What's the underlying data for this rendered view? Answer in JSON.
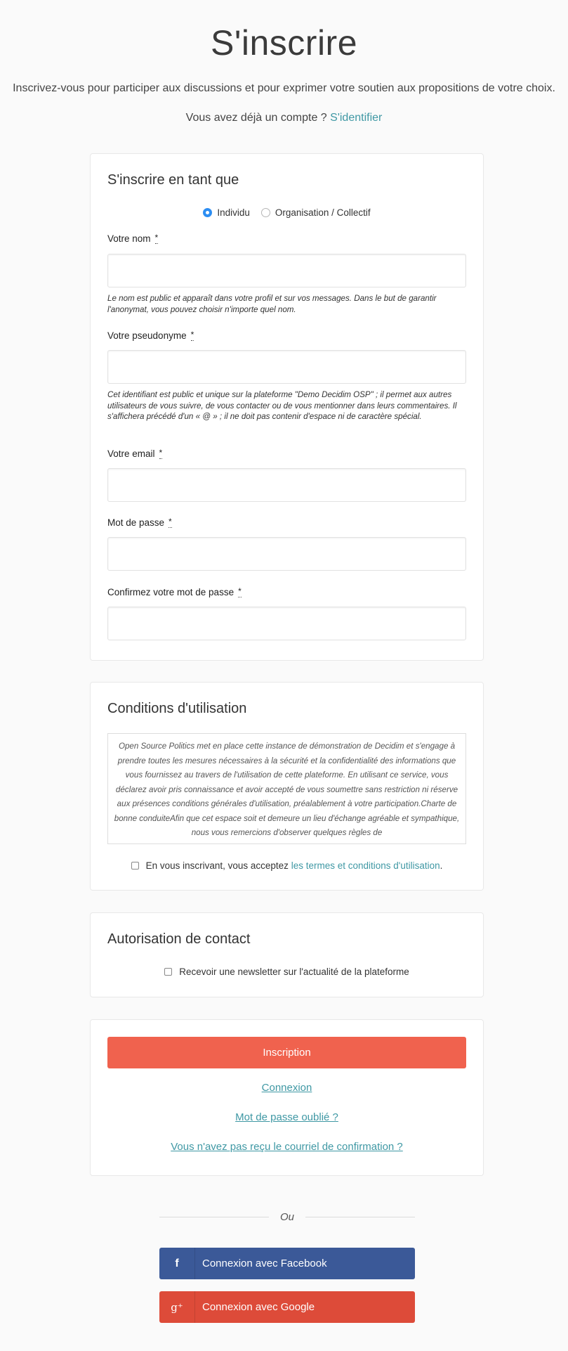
{
  "header": {
    "title": "S'inscrire",
    "subtitle": "Inscrivez-vous pour participer aux discussions et pour exprimer votre soutien aux propositions de votre choix.",
    "have_account": "Vous avez déjà un compte ?",
    "sign_in_link": "S'identifier"
  },
  "signup": {
    "title": "S'inscrire en tant que",
    "user_types": [
      {
        "label": "Individu",
        "selected": true
      },
      {
        "label": "Organisation / Collectif",
        "selected": false
      }
    ],
    "required_mark": "*",
    "fields": {
      "name": {
        "label": "Votre nom",
        "value": "",
        "help": "Le nom est public et apparaît dans votre profil et sur vos messages. Dans le but de garantir l'anonymat, vous pouvez choisir n'importe quel nom."
      },
      "nickname": {
        "label": "Votre pseudonyme",
        "value": "",
        "help": "Cet identifiant est public et unique sur la plateforme \"Demo Decidim OSP\" ; il permet aux autres utilisateurs de vous suivre, de vous contacter ou de vous mentionner dans leurs commentaires. Il s'affichera précédé d'un « @ » ; il ne doit pas contenir d'espace ni de caractère spécial."
      },
      "email": {
        "label": "Votre email",
        "value": ""
      },
      "password": {
        "label": "Mot de passe",
        "value": ""
      },
      "password_confirm": {
        "label": "Confirmez votre mot de passe",
        "value": ""
      }
    }
  },
  "tos": {
    "title": "Conditions d'utilisation",
    "text": "Open Source Politics met en place cette instance de démonstration de Decidim et s'engage à prendre toutes les mesures nécessaires à la sécurité et la confidentialité des informations que vous fournissez au travers de l'utilisation de cette plateforme. En utilisant ce service, vous déclarez avoir pris connaissance et avoir accepté de vous soumettre sans restriction ni réserve aux présences conditions générales d'utilisation, préalablement à votre participation.Charte de bonne conduiteAfin que cet espace soit et demeure un lieu d'échange agréable et sympathique, nous vous remercions d'observer quelques règles de",
    "agree_text": "En vous inscrivant, vous acceptez",
    "agree_link": "les termes et conditions d'utilisation",
    "agree_end": ".",
    "checked": false
  },
  "contact": {
    "title": "Autorisation de contact",
    "newsletter_label": "Recevoir une newsletter sur l'actualité de la plateforme",
    "checked": false
  },
  "actions": {
    "submit": "Inscription",
    "login": "Connexion",
    "forgot_password": "Mot de passe oublié ?",
    "no_confirmation": "Vous n'avez pas reçu le courriel de confirmation ?"
  },
  "social": {
    "or": "Ou",
    "facebook": {
      "label": "Connexion avec Facebook",
      "icon": "facebook-icon",
      "glyph": "f",
      "color": "#3b5998"
    },
    "google": {
      "label": "Connexion avec Google",
      "icon": "google-plus-icon",
      "glyph": "g⁺",
      "color": "#dd4b39"
    }
  },
  "colors": {
    "accent": "#3f98a4",
    "primary_button": "#f0624e",
    "radio_selected": "#2d8ef2"
  }
}
